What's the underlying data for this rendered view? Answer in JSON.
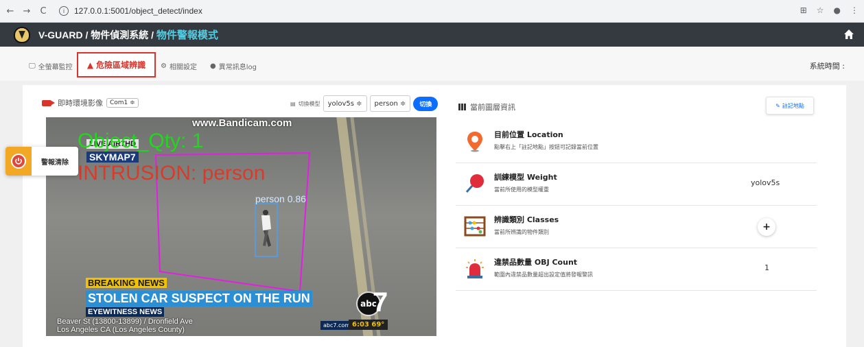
{
  "browser": {
    "url": "127.0.0.1:5001/object_detect/index",
    "nav": [
      "←",
      "→",
      "C"
    ]
  },
  "header": {
    "brand": "V-GUARD / 物件偵測系統 / ",
    "mode": "物件警報模式"
  },
  "tabs": [
    {
      "label": "全螢幕監控",
      "icon": "monitor-icon"
    },
    {
      "label": "危險區域辨識",
      "icon": "warning-icon"
    },
    {
      "label": "相關設定",
      "icon": "gear-icon"
    },
    {
      "label": "異常訊息log",
      "icon": "chat-icon"
    }
  ],
  "system_time_label": "系統時間 :",
  "left_panel": {
    "title": "即時環境影像",
    "camera_select": "Com1 ≑",
    "switch_model_label": "切換模型",
    "model_select": "yolov5s ≑",
    "class_select": "person ≑",
    "switch_button": "切換"
  },
  "video_overlay": {
    "watermark": "www.Bandicam.com",
    "qty_text": "Object_Qty: 1",
    "intrusion_text": "INTRUSION: person",
    "live_tag": "LIVE AIR7HD",
    "skymap_tag": "SKYMAP7",
    "detection_label": "person 0.86",
    "news_break": "BREAKING NEWS",
    "news_main": "STOLEN CAR SUSPECT ON THE RUN",
    "news_eye": "EYEWITNESS NEWS",
    "news_location_1": "Beaver St (13800-13899) / Dronfield Ave",
    "news_location_2": "Los Angeles CA (Los Angeles County)",
    "abc_small": "abc7.com",
    "abc_time": "6:03  69°",
    "abc_logo": "abc",
    "abc_seven": "7"
  },
  "alarm": {
    "label": "警報清除"
  },
  "right_panel": {
    "title": "當前圖層資訊",
    "mark_button": "註記地點",
    "rows": [
      {
        "title": "目前位置 Location",
        "desc": "點擊右上「註記地點」按鈕可記錄當前位置",
        "value": ""
      },
      {
        "title": "訓練模型 Weight",
        "desc": "當前所使用的模型權重",
        "value": "yolov5s"
      },
      {
        "title": "辨識類別 Classes",
        "desc": "當前所辨識的物件類別",
        "value": "+"
      },
      {
        "title": "違禁品數量 OBJ Count",
        "desc": "範圍內違禁品數量超出設定值將發報警訊",
        "value": "1"
      }
    ]
  },
  "colors": {
    "header_bg": "#343a40",
    "mode_text": "#4fd0e6",
    "active_tab": "#d9342b",
    "primary": "#0d6efd",
    "alarm_orange": "#f3a825"
  }
}
